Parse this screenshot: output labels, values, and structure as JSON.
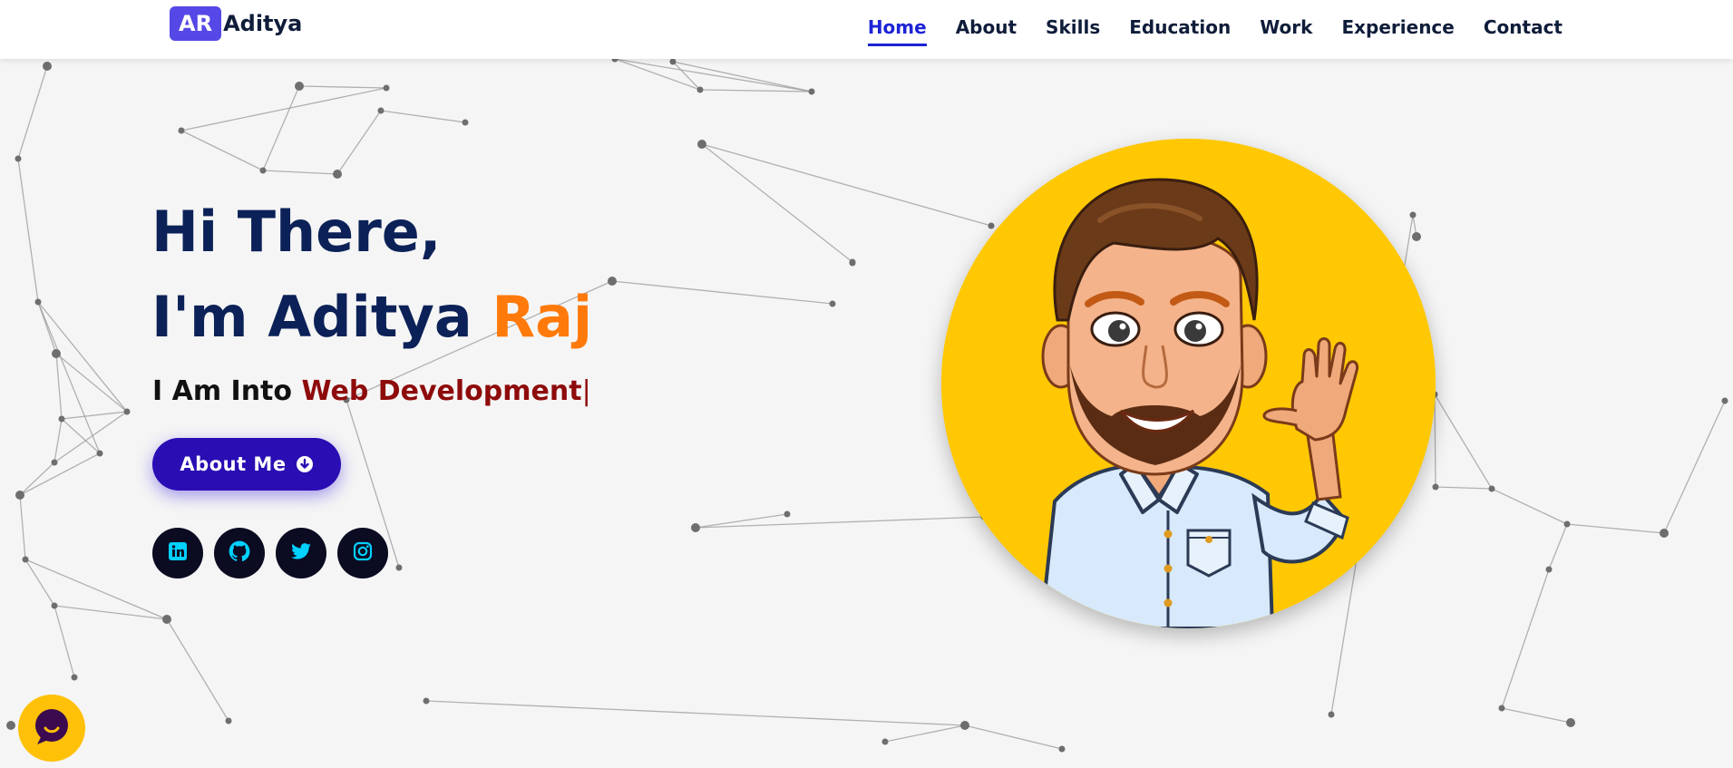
{
  "logo": {
    "badge": "AR",
    "name": "Aditya"
  },
  "nav": {
    "items": [
      {
        "label": "Home",
        "active": true
      },
      {
        "label": "About",
        "active": false
      },
      {
        "label": "Skills",
        "active": false
      },
      {
        "label": "Education",
        "active": false
      },
      {
        "label": "Work",
        "active": false
      },
      {
        "label": "Experience",
        "active": false
      },
      {
        "label": "Contact",
        "active": false
      }
    ]
  },
  "hero": {
    "greeting": "Hi There,",
    "intro": "I'm Aditya ",
    "name_accent": "Raj",
    "typed_prefix": "I Am Into ",
    "typed_role": "Web Development",
    "typed_cursor": "|",
    "cta_label": "About Me",
    "cta_icon": "arrow-down-circle-icon"
  },
  "socials": [
    {
      "name": "LinkedIn",
      "icon": "linkedin-icon"
    },
    {
      "name": "GitHub",
      "icon": "github-icon"
    },
    {
      "name": "Twitter",
      "icon": "twitter-icon"
    },
    {
      "name": "Instagram",
      "icon": "instagram-icon"
    }
  ],
  "avatar": {
    "icon": "cartoon-avatar-waving"
  },
  "chat": {
    "icon": "chat-bubble-icon"
  },
  "colors": {
    "brand_badge": "#5548e6",
    "nav_active": "#1d24d6",
    "heading": "#0b2157",
    "accent_orange": "#ff7a0a",
    "role_red": "#8e0b0b",
    "button": "#2a0db3",
    "social_bg": "#0b0b22",
    "social_icon": "#00d1ff",
    "avatar_bg": "#ffc803",
    "chat_bg": "#ffc107"
  }
}
